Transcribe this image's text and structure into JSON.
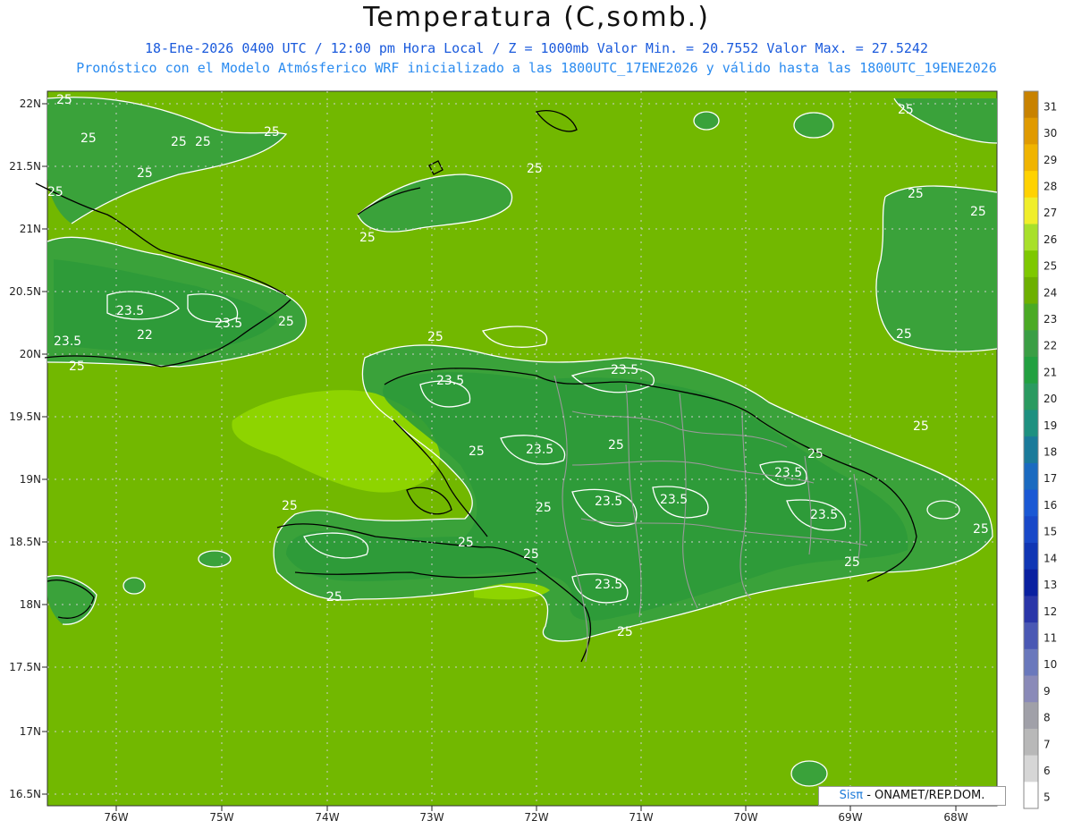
{
  "header": {
    "title": "Temperatura (C,somb.)",
    "subtitle_line1": "18-Ene-2026 0400 UTC / 12:00 pm Hora Local / Z = 1000mb  Valor Min. = 20.7552  Valor Max. = 27.5242",
    "subtitle_line2": "Pronóstico con el Modelo Atmósferico WRF inicializado a las 1800UTC_17ENE2026 y válido hasta las  1800UTC_19ENE2026"
  },
  "credit": {
    "brand": "Sisπ",
    "text": " - ONAMET/REP.DOM."
  },
  "axes": {
    "lat_labels": [
      "22N",
      "21.5N",
      "21N",
      "20.5N",
      "20N",
      "19.5N",
      "19N",
      "18.5N",
      "18N",
      "17.5N",
      "17N",
      "16.5N"
    ],
    "lon_labels": [
      "76W",
      "75W",
      "74W",
      "73W",
      "72W",
      "71W",
      "70W",
      "69W",
      "68W"
    ]
  },
  "colorbar": {
    "labels": [
      "31",
      "30",
      "29",
      "28",
      "27",
      "26",
      "25",
      "24",
      "23",
      "22",
      "21",
      "20",
      "19",
      "18",
      "17",
      "16",
      "15",
      "14",
      "13",
      "12",
      "11",
      "10",
      "9",
      "8",
      "7",
      "6",
      "5"
    ],
    "colors": [
      "#c88200",
      "#e09a00",
      "#f0b400",
      "#ffd200",
      "#f0ee2a",
      "#a8e02a",
      "#7ec800",
      "#6db000",
      "#4aaa24",
      "#3a9e44",
      "#22a040",
      "#2a9a60",
      "#1e9080",
      "#1a7a9a",
      "#1a6ac0",
      "#1a58d4",
      "#1848c8",
      "#1036b4",
      "#0a20a0",
      "#2a36a8",
      "#4a58b4",
      "#6a78bc",
      "#8a8ab8",
      "#a0a0a8",
      "#b8b8b8",
      "#d6d6d6",
      "#ffffff"
    ]
  },
  "field": {
    "background_color": "#72b800",
    "land_color": "#3aa23a",
    "warm_color": "#8ed400",
    "contour_color": "#ffffff",
    "coast_color": "#000000",
    "border_color": "#9a9a9a"
  },
  "contour_labels": [
    "25",
    "25",
    "25",
    "25",
    "25",
    "25",
    "25",
    "25",
    "25",
    "25",
    "25",
    "25",
    "25",
    "25",
    "25",
    "25",
    "25",
    "25",
    "25",
    "25",
    "23.5",
    "23.5",
    "23.5",
    "23.5",
    "23.5",
    "23.5",
    "23.5",
    "23.5",
    "23.5",
    "23.5",
    "23.5",
    "22"
  ]
}
